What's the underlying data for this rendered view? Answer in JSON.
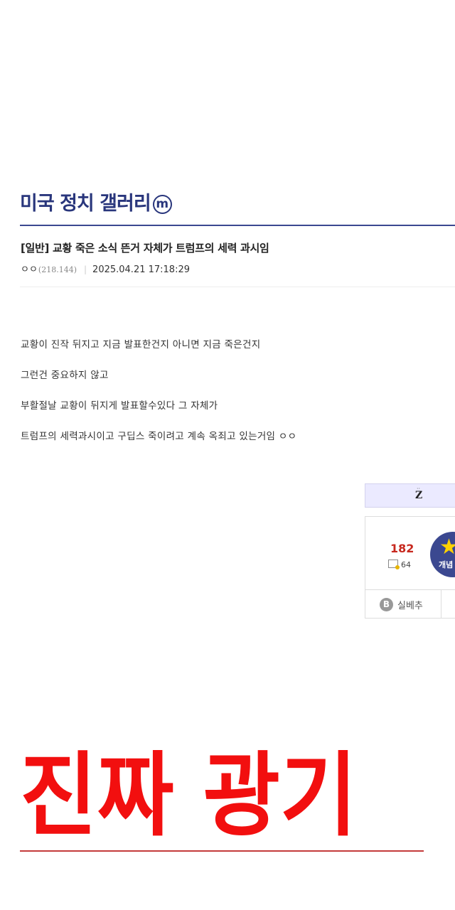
{
  "gallery": {
    "title": "미국 정치 갤러리",
    "badge": "m"
  },
  "post": {
    "title": "[일반] 교황 죽은 소식 뜬거 자체가 트럼프의 세력 과시임",
    "author": "ㅇㅇ",
    "ip": "(218.144)",
    "datetime": "2025.04.21 17:18:29",
    "body": [
      "교황이 진작 뒤지고 지금 발표한건지 아니면 지금 죽은건지",
      "그런건 중요하지 않고",
      "부활절날 교황이 뒤지게 발표할수있다 그 자체가",
      "트럼프의 세력과시이고 구딥스 죽이려고 계속 옥죄고 있는거임 ㅇㅇ"
    ]
  },
  "recommend": {
    "tab_label": "Z",
    "count": "182",
    "fixed_count": "64",
    "button_label": "개념",
    "footer_label": "실베추",
    "footer_icon": "B"
  },
  "caption": {
    "text": "진짜 광기",
    "color": "#f20f0f"
  },
  "colors": {
    "brand": "#29367c",
    "recommend_count": "#c7281e"
  }
}
